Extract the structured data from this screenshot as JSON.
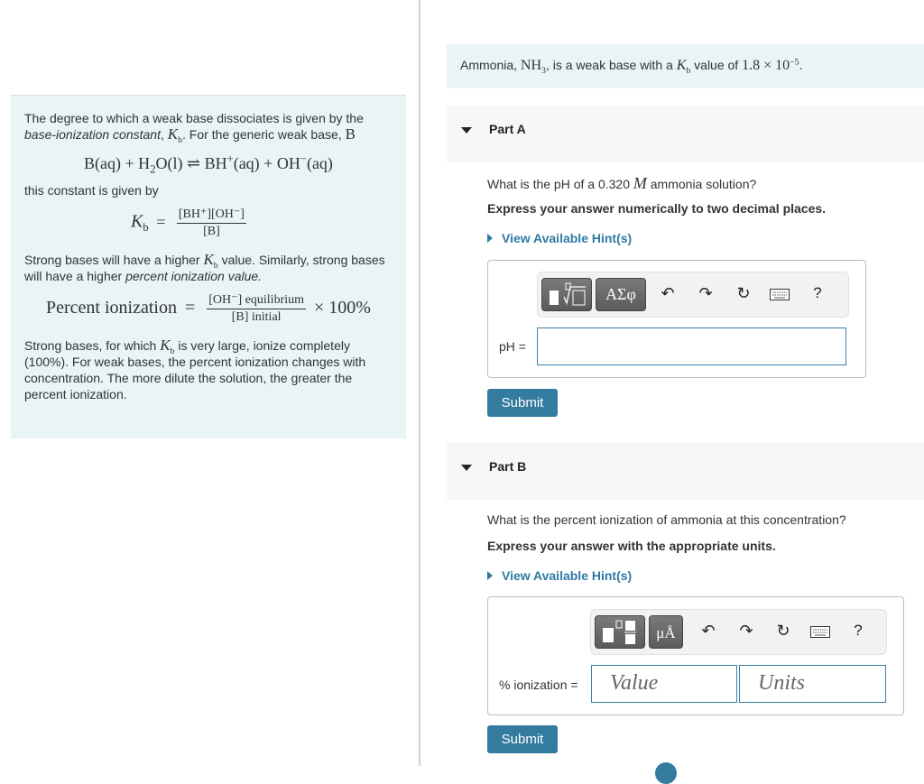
{
  "intro": {
    "p1_a": "The degree to which a weak base dissociates is given by the",
    "p1_b_italic": "base-ionization constant",
    "p1_c": ", ",
    "kb_symbol": "K",
    "kb_sub": "b",
    "p1_d": ". For the generic weak base, ",
    "p1_base": "B",
    "reaction": {
      "lhs": "B(aq) + H",
      "h2o_sub": "2",
      "h2o_rest": "O(l)",
      "arrow": "⇌",
      "bh": "BH",
      "bh_sup": "+",
      "bh_state": "(aq) + OH",
      "oh_sup": "−",
      "oh_state": "(aq)"
    },
    "p2": "this constant is given by",
    "kb_eq": {
      "lhs_K": "K",
      "lhs_sub": "b",
      "equals": "=",
      "numerator": "[BH⁺][OH⁻]",
      "denominator": "[B]"
    },
    "p3_a": "Strong bases will have a higher ",
    "p3_b": " value. Similarly, strong bases will have a higher ",
    "p3_italic": "percent ionization value.",
    "pi_eq": {
      "lhs": "Percent ionization",
      "equals": "=",
      "numerator": "[OH⁻] equilibrium",
      "denominator": "[B] initial",
      "times": "× 100%"
    },
    "p4_a": "Strong bases, for which ",
    "p4_b": " is very large, ionize completely (100%). For weak bases, the percent ionization changes with concentration. The more dilute the solution, the greater the percent ionization."
  },
  "problem": {
    "a": "Ammonia, ",
    "nh": "NH",
    "nh_sub": "3",
    "b": ", is a weak base with a ",
    "K": "K",
    "K_sub": "b",
    "c": " value of ",
    "value": "1.8 × 10",
    "exp": "−5",
    "d": "."
  },
  "partA": {
    "label": "Part A",
    "question_a": "What is the pH of a 0.320 ",
    "question_M": "M",
    "question_b": " ammonia solution?",
    "instruction": "Express your answer numerically to two decimal places.",
    "hint": "View Available Hint(s)",
    "toolbar": {
      "greek": "ΑΣφ",
      "help": "?"
    },
    "field_label": "pH =",
    "field_value": "",
    "submit": "Submit"
  },
  "partB": {
    "label": "Part B",
    "question": "What is the percent ionization of ammonia at this concentration?",
    "instruction": "Express your answer with the appropriate units.",
    "hint": "View Available Hint(s)",
    "toolbar": {
      "units": "μÅ",
      "help": "?"
    },
    "field_label": "% ionization =",
    "value_placeholder": "Value",
    "units_placeholder": "Units",
    "submit": "Submit"
  }
}
